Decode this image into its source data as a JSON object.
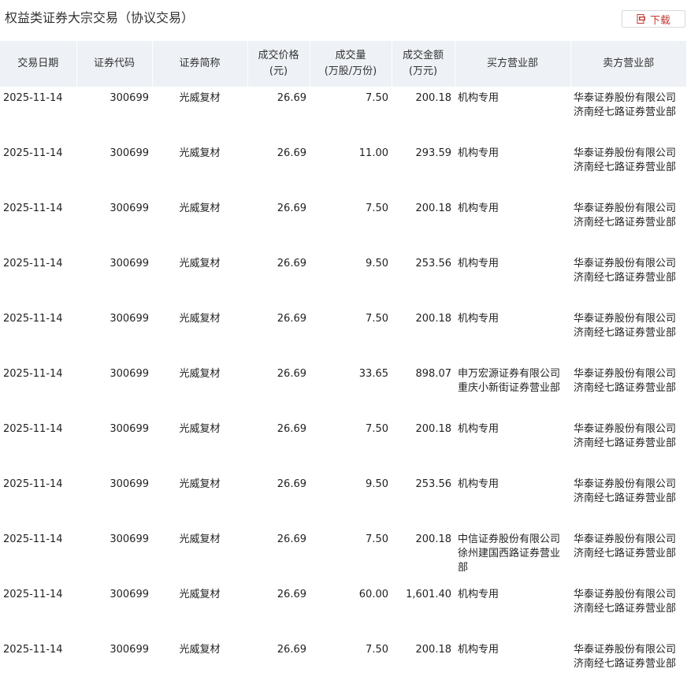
{
  "title": "权益类证券大宗交易（协议交易）",
  "download_label": "下载",
  "colors": {
    "accent": "#c23a31",
    "header_bg": "#eef1f5"
  },
  "columns": [
    {
      "key": "date",
      "label": "交易日期"
    },
    {
      "key": "code",
      "label": "证券代码"
    },
    {
      "key": "name",
      "label": "证券简称"
    },
    {
      "key": "price",
      "label": "成交价格(元)",
      "line1": "成交价格",
      "line2": "(元)"
    },
    {
      "key": "volume",
      "label": "成交量(万股/万份)",
      "line1": "成交量",
      "line2": "(万股/万份)"
    },
    {
      "key": "amount",
      "label": "成交金额(万元)",
      "line1": "成交金额",
      "line2": "(万元)"
    },
    {
      "key": "buyer",
      "label": "买方营业部"
    },
    {
      "key": "seller",
      "label": "卖方营业部"
    }
  ],
  "rows": [
    {
      "date": "2025-11-14",
      "code": "300699",
      "name": "光威复材",
      "price": "26.69",
      "volume": "7.50",
      "amount": "200.18",
      "buyer": "机构专用",
      "seller": "华泰证券股份有限公司济南经七路证券营业部"
    },
    {
      "date": "2025-11-14",
      "code": "300699",
      "name": "光威复材",
      "price": "26.69",
      "volume": "11.00",
      "amount": "293.59",
      "buyer": "机构专用",
      "seller": "华泰证券股份有限公司济南经七路证券营业部"
    },
    {
      "date": "2025-11-14",
      "code": "300699",
      "name": "光威复材",
      "price": "26.69",
      "volume": "7.50",
      "amount": "200.18",
      "buyer": "机构专用",
      "seller": "华泰证券股份有限公司济南经七路证券营业部"
    },
    {
      "date": "2025-11-14",
      "code": "300699",
      "name": "光威复材",
      "price": "26.69",
      "volume": "9.50",
      "amount": "253.56",
      "buyer": "机构专用",
      "seller": "华泰证券股份有限公司济南经七路证券营业部"
    },
    {
      "date": "2025-11-14",
      "code": "300699",
      "name": "光威复材",
      "price": "26.69",
      "volume": "7.50",
      "amount": "200.18",
      "buyer": "机构专用",
      "seller": "华泰证券股份有限公司济南经七路证券营业部"
    },
    {
      "date": "2025-11-14",
      "code": "300699",
      "name": "光威复材",
      "price": "26.69",
      "volume": "33.65",
      "amount": "898.07",
      "buyer": "申万宏源证券有限公司重庆小新街证券营业部",
      "seller": "华泰证券股份有限公司济南经七路证券营业部"
    },
    {
      "date": "2025-11-14",
      "code": "300699",
      "name": "光威复材",
      "price": "26.69",
      "volume": "7.50",
      "amount": "200.18",
      "buyer": "机构专用",
      "seller": "华泰证券股份有限公司济南经七路证券营业部"
    },
    {
      "date": "2025-11-14",
      "code": "300699",
      "name": "光威复材",
      "price": "26.69",
      "volume": "9.50",
      "amount": "253.56",
      "buyer": "机构专用",
      "seller": "华泰证券股份有限公司济南经七路证券营业部"
    },
    {
      "date": "2025-11-14",
      "code": "300699",
      "name": "光威复材",
      "price": "26.69",
      "volume": "7.50",
      "amount": "200.18",
      "buyer": "中信证券股份有限公司徐州建国西路证券营业部",
      "seller": "华泰证券股份有限公司济南经七路证券营业部"
    },
    {
      "date": "2025-11-14",
      "code": "300699",
      "name": "光威复材",
      "price": "26.69",
      "volume": "60.00",
      "amount": "1,601.40",
      "buyer": "机构专用",
      "seller": "华泰证券股份有限公司济南经七路证券营业部"
    },
    {
      "date": "2025-11-14",
      "code": "300699",
      "name": "光威复材",
      "price": "26.69",
      "volume": "7.50",
      "amount": "200.18",
      "buyer": "机构专用",
      "seller": "华泰证券股份有限公司济南经七路证券营业部"
    }
  ]
}
